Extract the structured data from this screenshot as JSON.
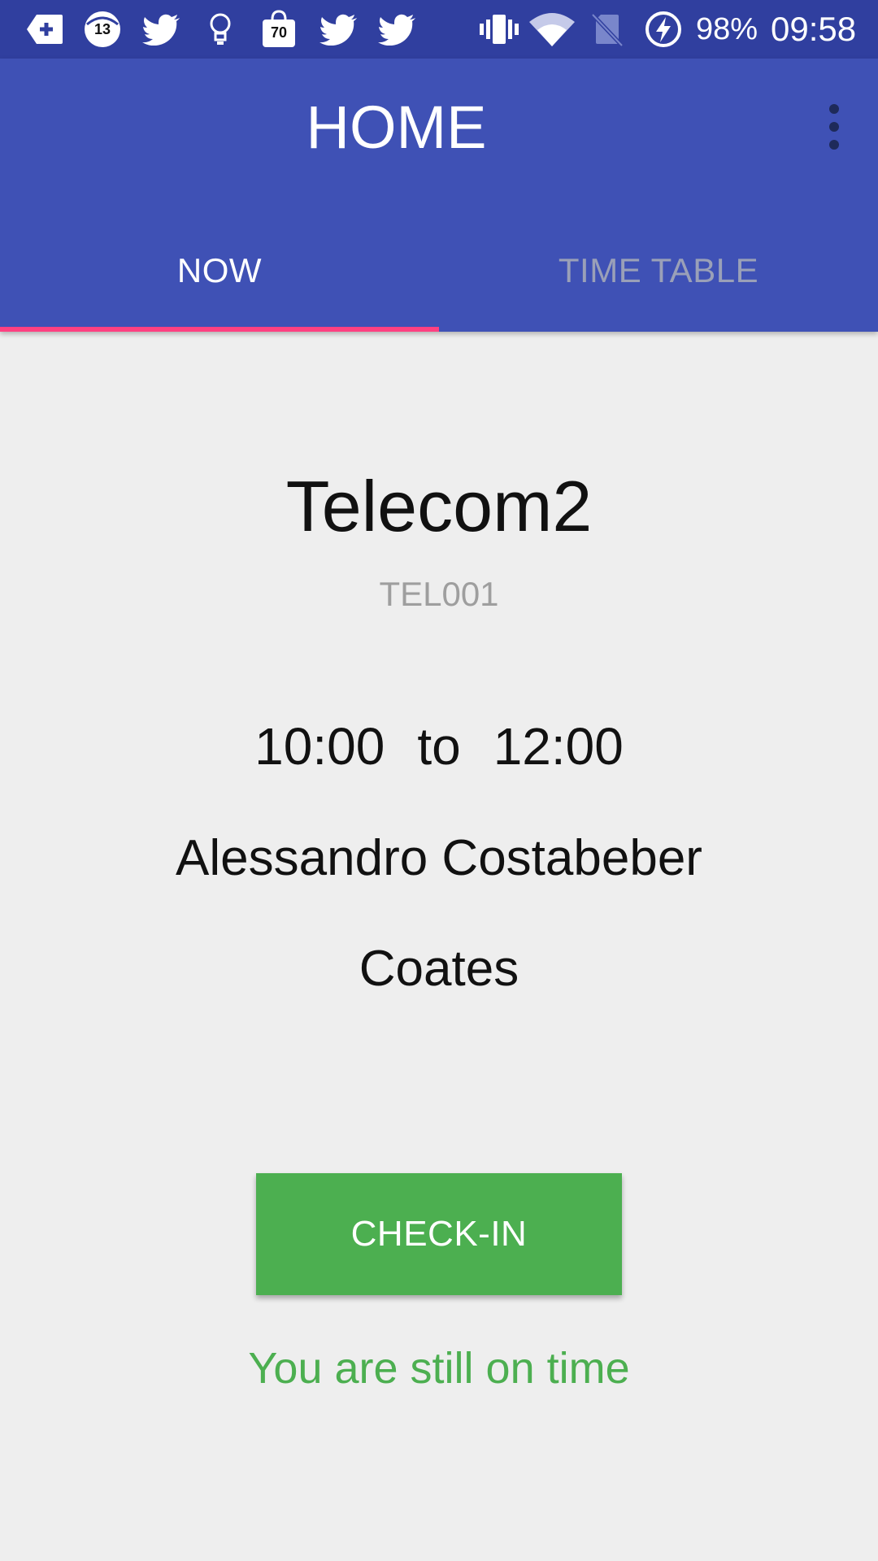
{
  "status_bar": {
    "notification_icons": [
      "add-tag-icon",
      "badge-13-icon",
      "twitter-icon",
      "lightbulb-icon",
      "shopping-bag-70-icon",
      "twitter-icon",
      "twitter-icon"
    ],
    "badge_a": "13",
    "badge_b": "70",
    "system_icons": [
      "vibrate-icon",
      "wifi-icon",
      "no-sim-icon",
      "battery-charging-icon"
    ],
    "battery": "98%",
    "time": "09:58"
  },
  "app_bar": {
    "title": "HOME",
    "menu_icon": "overflow-menu-icon"
  },
  "tabs": [
    {
      "label": "NOW",
      "active": true
    },
    {
      "label": "TIME TABLE",
      "active": false
    }
  ],
  "class_info": {
    "name": "Telecom2",
    "code": "TEL001",
    "start_time": "10:00",
    "separator": "to",
    "end_time": "12:00",
    "lecturer": "Alessandro Costabeber",
    "room": "Coates"
  },
  "checkin": {
    "button_label": "CHECK-IN",
    "status_message": "You are still on time"
  },
  "colors": {
    "primary": "#3f51b5",
    "primary_dark": "#303f9f",
    "accent": "#ff4081",
    "success": "#4caf50",
    "background": "#eeeeee"
  }
}
